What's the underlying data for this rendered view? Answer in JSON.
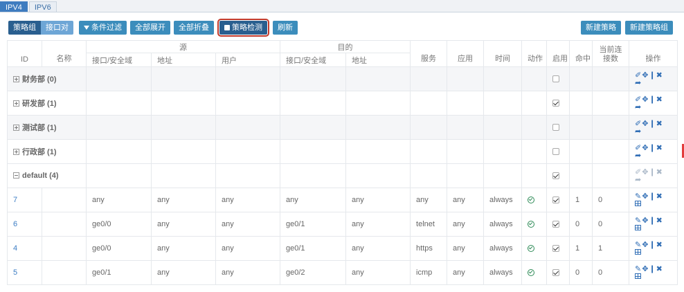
{
  "tabs": [
    {
      "label": "IPV4",
      "active": true
    },
    {
      "label": "IPV6",
      "active": false
    }
  ],
  "toolbar": {
    "view_group": "策略组",
    "view_iface": "接口对",
    "filter": "条件过滤",
    "expand_all": "全部展开",
    "collapse_all": "全部折叠",
    "detect": "策略检测",
    "refresh": "刷新",
    "new_policy": "新建策略",
    "new_group": "新建策略组"
  },
  "headers": {
    "source": "源",
    "dest": "目的",
    "id": "ID",
    "name": "名称",
    "src_iface": "接口/安全域",
    "src_addr": "地址",
    "src_user": "用户",
    "dst_iface": "接口/安全域",
    "dst_addr": "地址",
    "service": "服务",
    "app": "应用",
    "time": "时间",
    "action": "动作",
    "enabled": "启用",
    "hits": "命中",
    "conn_line1": "当前连",
    "conn_line2": "接数",
    "ops": "操作"
  },
  "groups": [
    {
      "label": "财务部 (0)",
      "enabled": false
    },
    {
      "label": "研发部 (1)",
      "enabled": true
    },
    {
      "label": "测试部 (1)",
      "enabled": false
    },
    {
      "label": "行政部 (1)",
      "enabled": false
    },
    {
      "label": "default (4)",
      "enabled": true
    }
  ],
  "rows": [
    {
      "id": "7",
      "src_iface": "any",
      "src_addr": "any",
      "src_user": "any",
      "dst_iface": "any",
      "dst_addr": "any",
      "service": "any",
      "app": "any",
      "time": "always",
      "hits": "1",
      "conn": "0"
    },
    {
      "id": "6",
      "src_iface": "ge0/0",
      "src_addr": "any",
      "src_user": "any",
      "dst_iface": "ge0/1",
      "dst_addr": "any",
      "service": "telnet",
      "app": "any",
      "time": "always",
      "hits": "0",
      "conn": "0"
    },
    {
      "id": "4",
      "src_iface": "ge0/0",
      "src_addr": "any",
      "src_user": "any",
      "dst_iface": "ge0/1",
      "dst_addr": "any",
      "service": "https",
      "app": "any",
      "time": "always",
      "hits": "1",
      "conn": "1"
    },
    {
      "id": "5",
      "src_iface": "ge0/1",
      "src_addr": "any",
      "src_user": "any",
      "dst_iface": "ge0/2",
      "dst_addr": "any",
      "service": "icmp",
      "app": "any",
      "time": "always",
      "hits": "0",
      "conn": "0"
    }
  ],
  "colors": {
    "primary": "#3c8dbc",
    "dark": "#2a5f8f",
    "highlight": "#c0392b"
  }
}
